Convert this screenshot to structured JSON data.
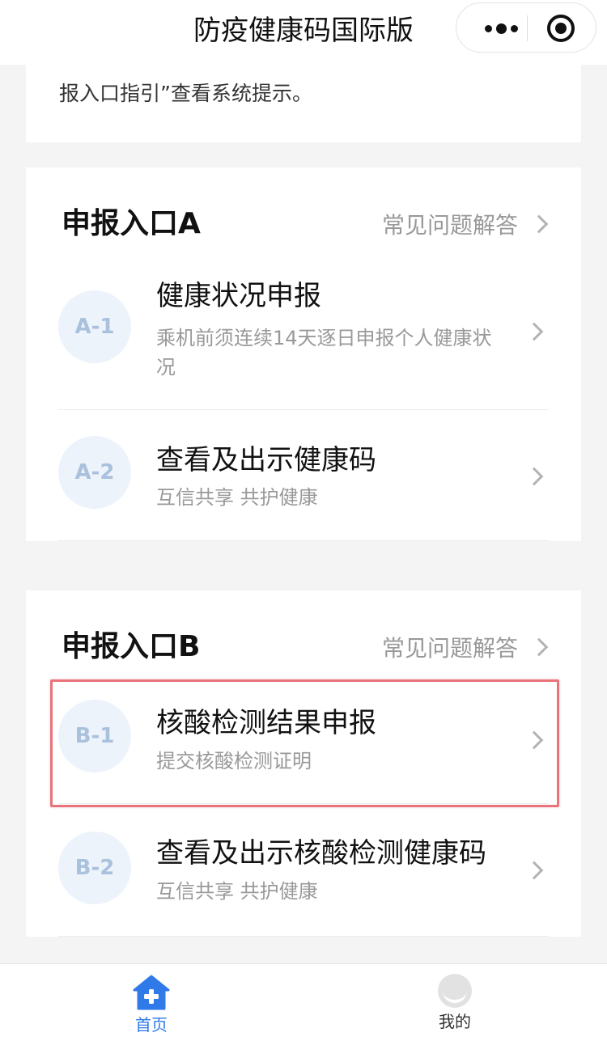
{
  "navbar": {
    "title": "防疫健康码国际版",
    "more_icon": "more-dots-icon",
    "close_icon": "target-circle-icon"
  },
  "notice": {
    "text": "报入口指引”查看系统提示。"
  },
  "section_a": {
    "title": "申报入口A",
    "faq_label": "常见问题解答",
    "items": [
      {
        "badge": "A-1",
        "title": "健康状况申报",
        "subtitle": "乘机前须连续14天逐日申报个人健康状况"
      },
      {
        "badge": "A-2",
        "title": "查看及出示健康码",
        "subtitle": "互信共享 共护健康"
      }
    ]
  },
  "section_b": {
    "title": "申报入口B",
    "faq_label": "常见问题解答",
    "items": [
      {
        "badge": "B-1",
        "title": "核酸检测结果申报",
        "subtitle": "提交核酸检测证明"
      },
      {
        "badge": "B-2",
        "title": "查看及出示核酸检测健康码",
        "subtitle": "互信共享 共护健康"
      }
    ]
  },
  "tabbar": {
    "tabs": [
      {
        "label": "首页",
        "icon": "home-plus-icon",
        "active": true
      },
      {
        "label": "我的",
        "icon": "profile-icon",
        "active": false
      }
    ]
  },
  "colors": {
    "accent": "#2f7ae8",
    "badge_bg": "#edf3fb",
    "badge_text": "#a9c1dc",
    "highlight": "#e8737b"
  }
}
